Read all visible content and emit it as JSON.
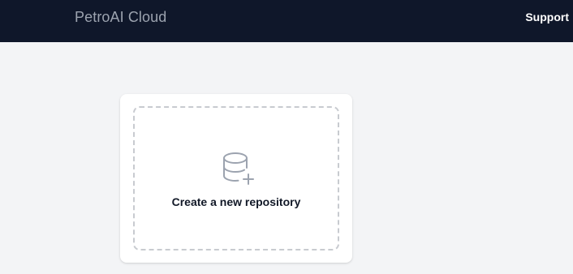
{
  "header": {
    "brand": "PetroAI Cloud",
    "support_label": "Support"
  },
  "main": {
    "create_repository_label": "Create a new repository",
    "create_repository_icon": "database-plus-icon"
  },
  "colors": {
    "header_bg": "#0f172a",
    "page_bg": "#f3f4f6",
    "icon_stroke": "#9ca3af"
  }
}
